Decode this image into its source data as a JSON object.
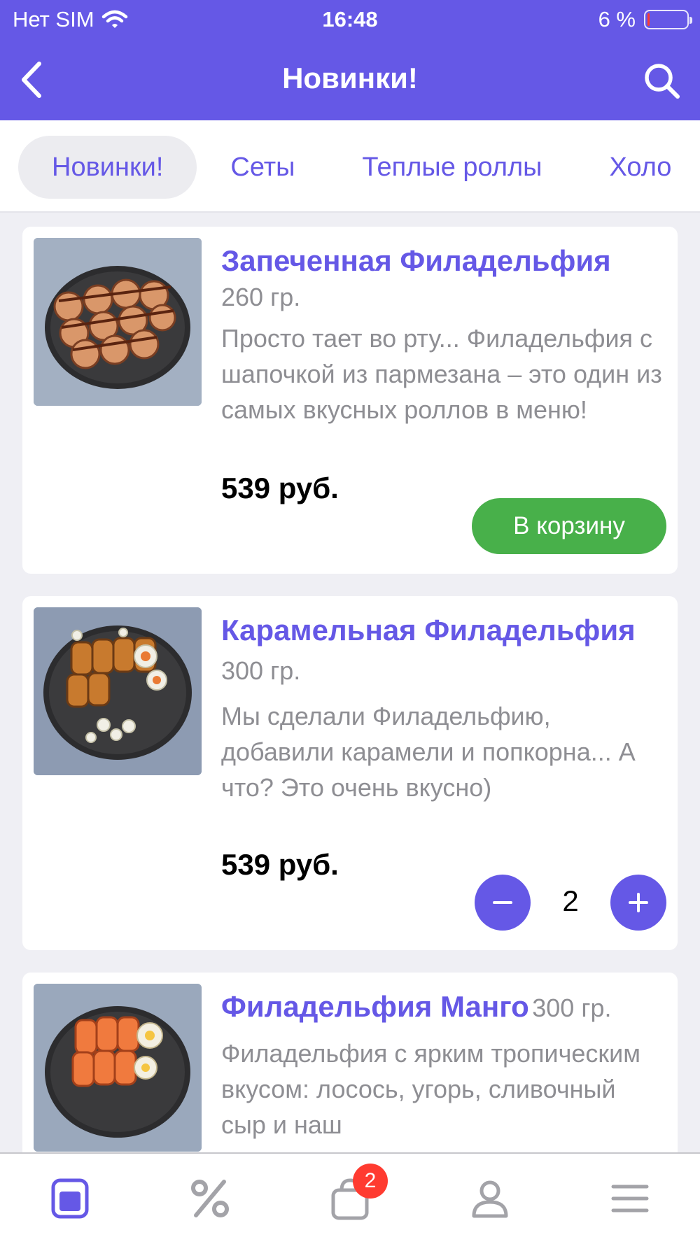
{
  "status_bar": {
    "carrier": "Нет SIM",
    "time": "16:48",
    "battery": "6 %",
    "battery_level": 0.06
  },
  "header": {
    "title": "Новинки!"
  },
  "category_tabs": [
    {
      "label": "Новинки!",
      "active": true
    },
    {
      "label": "Сеты",
      "active": false
    },
    {
      "label": "Теплые роллы",
      "active": false
    },
    {
      "label": "Холо",
      "active": false
    }
  ],
  "products": [
    {
      "name": "Запеченная Филадельфия",
      "weight": "260 гр.",
      "description": "Просто тает во рту... Филадельфия с шапочкой из пармезана – это один из самых вкусных роллов в меню!",
      "price": "539 руб.",
      "action_label": "В корзину"
    },
    {
      "name": "Карамельная Филадельфия",
      "weight": "300 гр.",
      "description": "Мы сделали Филадельфию, добавили карамели и попкорна... А что? Это очень вкусно)",
      "price": "539 руб.",
      "quantity": "2"
    },
    {
      "name": "Филадельфия Манго",
      "weight": "300 гр.",
      "description": "Филадельфия с ярким тропическим вкусом: лосось, угорь, сливочный сыр и наш"
    }
  ],
  "tab_bar": {
    "items": [
      "menu-icon",
      "percent-icon",
      "cart-icon",
      "profile-icon",
      "hamburger-icon"
    ],
    "cart_badge": "2"
  },
  "colors": {
    "accent": "#6558e6",
    "cart_button": "#48b04a",
    "badge": "#ff3b30",
    "inactive_icon": "#a3a3a8"
  }
}
